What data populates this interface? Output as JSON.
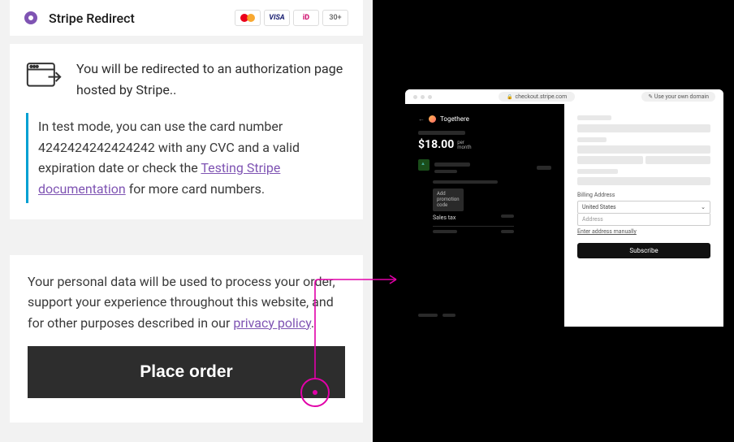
{
  "payment": {
    "title": "Stripe Redirect",
    "brands": {
      "visa": "VISA",
      "ideal": "iD",
      "more": "30+"
    }
  },
  "redirect": {
    "message": "You will be redirected to an authorization page hosted by Stripe..",
    "info_prefix": "In test mode, you can use the card number 4242424242424242 with any CVC and a valid expiration date or check the ",
    "info_link": "Testing Stripe documentation",
    "info_suffix": " for more card numbers."
  },
  "privacy": {
    "text_prefix": "Your personal data will be used to process your order, support your experience throughout this website, and for other purposes described in our ",
    "link": "privacy policy",
    "text_suffix": "."
  },
  "button": {
    "place_order": "Place order"
  },
  "preview": {
    "url": "checkout.stripe.com",
    "own_domain": "Use your own domain",
    "merchant": "Togethere",
    "price": "$18.00",
    "per_line1": "per",
    "per_line2": "month",
    "promo": "Add promotion code",
    "sales_tax": "Sales tax",
    "billing_label": "Billing Address",
    "country": "United States",
    "address_placeholder": "Address",
    "manual": "Enter address manually",
    "subscribe": "Subscribe"
  }
}
